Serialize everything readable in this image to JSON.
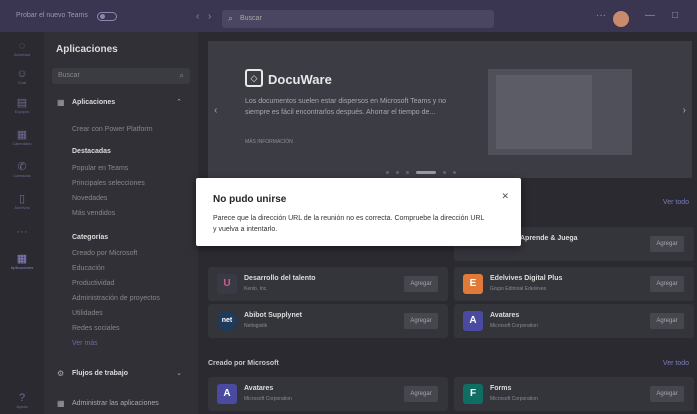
{
  "titlebar": {
    "toggle_label": "Probar el nuevo Teams",
    "search_placeholder": "Buscar",
    "more": "···",
    "minimize": "—",
    "maximize": "□"
  },
  "rail": [
    {
      "icon": "activity-icon",
      "glyph": "◌",
      "label": "Actividad"
    },
    {
      "icon": "chat-icon",
      "glyph": "☺",
      "label": "Chat"
    },
    {
      "icon": "teams-icon",
      "glyph": "▤",
      "label": "Equipos"
    },
    {
      "icon": "calendar-icon",
      "glyph": "▦",
      "label": "Calendario"
    },
    {
      "icon": "calls-icon",
      "glyph": "✆",
      "label": "Llamadas"
    },
    {
      "icon": "files-icon",
      "glyph": "▯",
      "label": "Archivos"
    },
    {
      "icon": "more-icon",
      "glyph": "···",
      "label": ""
    },
    {
      "icon": "apps-icon",
      "glyph": "▦",
      "label": "Aplicaciones"
    },
    {
      "icon": "help-icon",
      "glyph": "?",
      "label": "Ayuda"
    }
  ],
  "panel": {
    "title": "Aplicaciones",
    "search_placeholder": "Buscar",
    "section_apps": "Aplicaciones",
    "create_power": "Crear con Power Platform",
    "featured": "Destacadas",
    "popular": "Popular en Teams",
    "top_picks": "Principales selecciones",
    "new": "Novedades",
    "most_sold": "Más vendidos",
    "categories": "Categorías",
    "cat_items": [
      "Creado por Microsoft",
      "Educación",
      "Productividad",
      "Administración de proyectos",
      "Utilidades",
      "Redes sociales"
    ],
    "see_more": "Ver más",
    "workflows": "Flujos de trabajo",
    "manage_apps": "Administrar las aplicaciones"
  },
  "banner": {
    "brand": "DocuWare",
    "desc_line1": "Los documentos suelen estar dispersos en Microsoft Teams y no",
    "desc_line2": "siempre es fácil encontrarlos después. Ahorrar el tiempo de...",
    "more_info": "MÁS INFORMACIÓN",
    "prev": "‹",
    "next": "›"
  },
  "sections": {
    "see_all": "Ver todo",
    "by_microsoft": "Creado por Microsoft"
  },
  "cards": [
    {
      "name": "Desarrollo del talento",
      "pub": "Kenlo, Inc.",
      "add": "Agregar",
      "logo": "U",
      "color": "#3a3a44"
    },
    {
      "name": "Edelvives Digital Plus",
      "pub": "Grupo Editorial Edelvives",
      "add": "Agregar",
      "logo": "E",
      "color": "#e07a3a"
    },
    {
      "name": "Abibot Supplynet",
      "pub": "Netlogistik",
      "add": "Agregar",
      "logo": "net",
      "color": "#1f3a5a"
    },
    {
      "name": "Avatares",
      "pub": "Microsoft Corporation",
      "add": "Agregar",
      "logo": "A",
      "color": "#4a4aa0"
    },
    {
      "name": "Avatares",
      "pub": "Microsoft Corporation",
      "add": "Agregar",
      "logo": "A",
      "color": "#4a4aa0"
    },
    {
      "name": "Forms",
      "pub": "Microsoft Corporation",
      "add": "Agregar",
      "logo": "F",
      "color": "#0f6e63"
    }
  ],
  "partial_card": {
    "name": "Aprende & Juega",
    "add": "Agregar"
  },
  "dialog": {
    "title": "No pudo unirse",
    "line1": "Parece que la dirección URL de la reunión no es correcta. Compruebe la dirección URL",
    "line2": "y vuelva a intentarlo.",
    "close": "✕"
  }
}
